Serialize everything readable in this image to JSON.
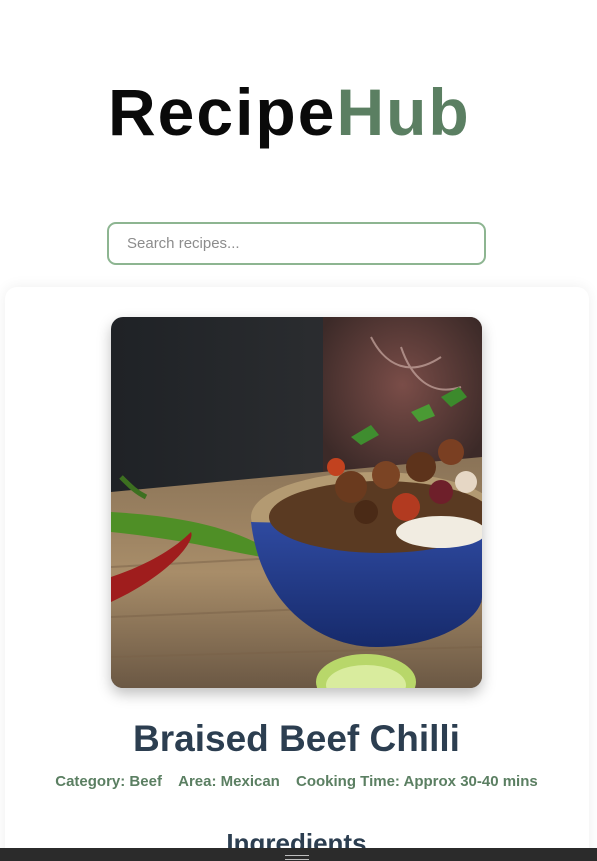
{
  "header": {
    "logo_part1": "Recipe",
    "logo_part2": "Hub"
  },
  "search": {
    "placeholder": "Search recipes..."
  },
  "recipe": {
    "image_alt": "Braised Beef Chilli in a blue bowl with rice",
    "title": "Braised Beef Chilli",
    "category": "Category: Beef",
    "area": "Area: Mexican",
    "cooking_time": "Cooking Time: Approx 30-40 mins",
    "ingredients_heading": "Ingredients"
  },
  "colors": {
    "accent": "#5b7f62",
    "heading": "#2c3e50",
    "search_border": "#8db591"
  },
  "icons": {
    "bottom_handle": "drag-handle-icon"
  }
}
